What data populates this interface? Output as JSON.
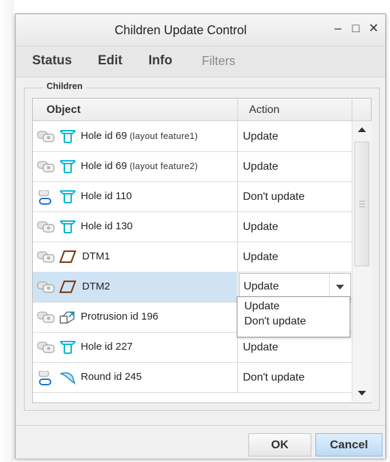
{
  "window": {
    "title": "Children Update Control",
    "controls": [
      "–",
      "□",
      "✕"
    ]
  },
  "menu": [
    "Status",
    "Edit",
    "Info",
    "Filters"
  ],
  "group_label": "Children",
  "table": {
    "headers": {
      "object": "Object",
      "action": "Action"
    },
    "rows": [
      {
        "name": "Hole id 69",
        "note": "(layout feature1)",
        "action": "Update",
        "link_icon": "linked-update-icon",
        "feature_icon": "hole-feature-icon"
      },
      {
        "name": "Hole id 69",
        "note": "(layout feature2)",
        "action": "Update",
        "link_icon": "linked-update-icon",
        "feature_icon": "hole-feature-icon"
      },
      {
        "name": "Hole id 110",
        "note": "",
        "action": "Don't update",
        "link_icon": "unlinked-icon",
        "feature_icon": "hole-feature-icon"
      },
      {
        "name": "Hole id 130",
        "note": "",
        "action": "Update",
        "link_icon": "linked-update-icon",
        "feature_icon": "hole-feature-icon"
      },
      {
        "name": "DTM1",
        "note": "",
        "action": "Update",
        "link_icon": "linked-update-icon",
        "feature_icon": "datum-plane-icon"
      },
      {
        "name": "DTM2",
        "note": "",
        "action": "Update",
        "link_icon": "linked-update-icon",
        "feature_icon": "datum-plane-icon",
        "selected": true
      },
      {
        "name": "Protrusion id 196",
        "note": "",
        "action": "",
        "link_icon": "linked-update-icon",
        "feature_icon": "protrusion-feature-icon"
      },
      {
        "name": "Hole id 227",
        "note": "",
        "action": "Update",
        "link_icon": "linked-update-icon",
        "feature_icon": "hole-feature-icon"
      },
      {
        "name": "Round id 245",
        "note": "",
        "action": "Don't update",
        "link_icon": "unlinked-icon",
        "feature_icon": "round-feature-icon"
      }
    ],
    "dropdown_options": [
      "Update",
      "Don't update"
    ]
  },
  "buttons": {
    "ok": "OK",
    "cancel": "Cancel"
  },
  "colors": {
    "selected_row": "#cfe3f5",
    "feature_icon": "#00b4d8",
    "datum_icon": "#7a3b1a",
    "link_icon": "#1a6fd6"
  }
}
